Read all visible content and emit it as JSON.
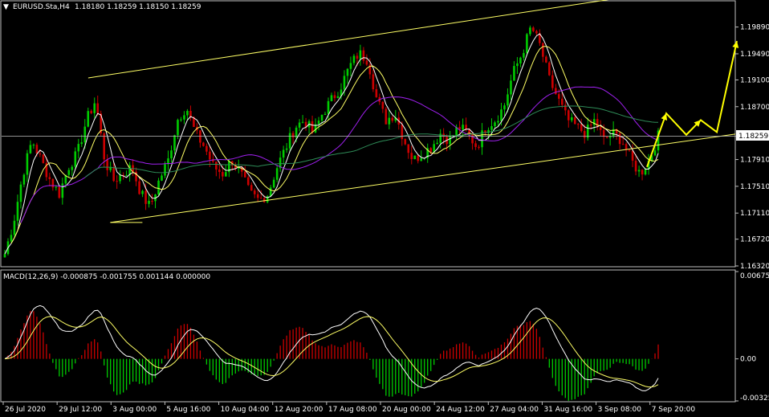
{
  "header": {
    "symbol": "EURUSD.Sta,H4",
    "ohlc": "1.18180 1.18259 1.18150 1.18259"
  },
  "macd_header": "MACD(12,26,9) -0.000875 -0.001755 0.001144 0.000000",
  "current_price_label": "1.18259",
  "colors": {
    "background": "#000000",
    "bull": "#00cc00",
    "bear": "#cc0000",
    "channel": "#ffff66",
    "ma_fast": "#ffffff",
    "ma_mid": "#ffff66",
    "ma_slow": "#a020f0",
    "ma_long": "#2e8b57",
    "arrow": "#ffff00",
    "grid_frame": "#c0c0c0"
  },
  "chart_data": [
    {
      "type": "candlestick",
      "ylim": [
        1.1632,
        1.2027
      ],
      "price_ticks": [
        "1.19890",
        "1.19490",
        "1.19100",
        "1.18700",
        "1.18259",
        "1.17910",
        "1.17510",
        "1.17110",
        "1.16720",
        "1.16320"
      ],
      "x_ticks": [
        "26 Jul 2020",
        "29 Jul 12:00",
        "3 Aug 00:00",
        "5 Aug 16:00",
        "10 Aug 04:00",
        "12 Aug 20:00",
        "17 Aug 08:00",
        "20 Aug 00:00",
        "24 Aug 12:00",
        "27 Aug 04:00",
        "31 Aug 16:00",
        "3 Sep 08:00",
        "7 Sep 20:00"
      ],
      "close_path": [
        1.165,
        1.17,
        1.177,
        1.182,
        1.179,
        1.176,
        1.174,
        1.178,
        1.18,
        1.185,
        1.188,
        1.179,
        1.176,
        1.177,
        1.178,
        1.174,
        1.172,
        1.176,
        1.179,
        1.185,
        1.187,
        1.183,
        1.181,
        1.178,
        1.177,
        1.179,
        1.177,
        1.174,
        1.173,
        1.174,
        1.178,
        1.181,
        1.184,
        1.185,
        1.183,
        1.186,
        1.188,
        1.19,
        1.193,
        1.195,
        1.194,
        1.188,
        1.185,
        1.186,
        1.182,
        1.179,
        1.18,
        1.181,
        1.183,
        1.182,
        1.184,
        1.183,
        1.181,
        1.184,
        1.185,
        1.187,
        1.192,
        1.195,
        1.199,
        1.196,
        1.191,
        1.188,
        1.185,
        1.184,
        1.183,
        1.185,
        1.182,
        1.183,
        1.182,
        1.179,
        1.177,
        1.179,
        1.1826
      ],
      "channel": {
        "upper": [
          [
            0.12,
            1.1913
          ],
          [
            0.84,
            1.2032
          ]
        ],
        "lower": [
          [
            0.15,
            1.1697
          ],
          [
            1.0,
            1.1829
          ]
        ]
      }
    },
    {
      "type": "macd",
      "name": "MACD(12,26,9)",
      "ylim": [
        -0.003254,
        0.006751
      ],
      "ticks": [
        "0.006751",
        "0.00",
        "-0.003254"
      ]
    }
  ]
}
